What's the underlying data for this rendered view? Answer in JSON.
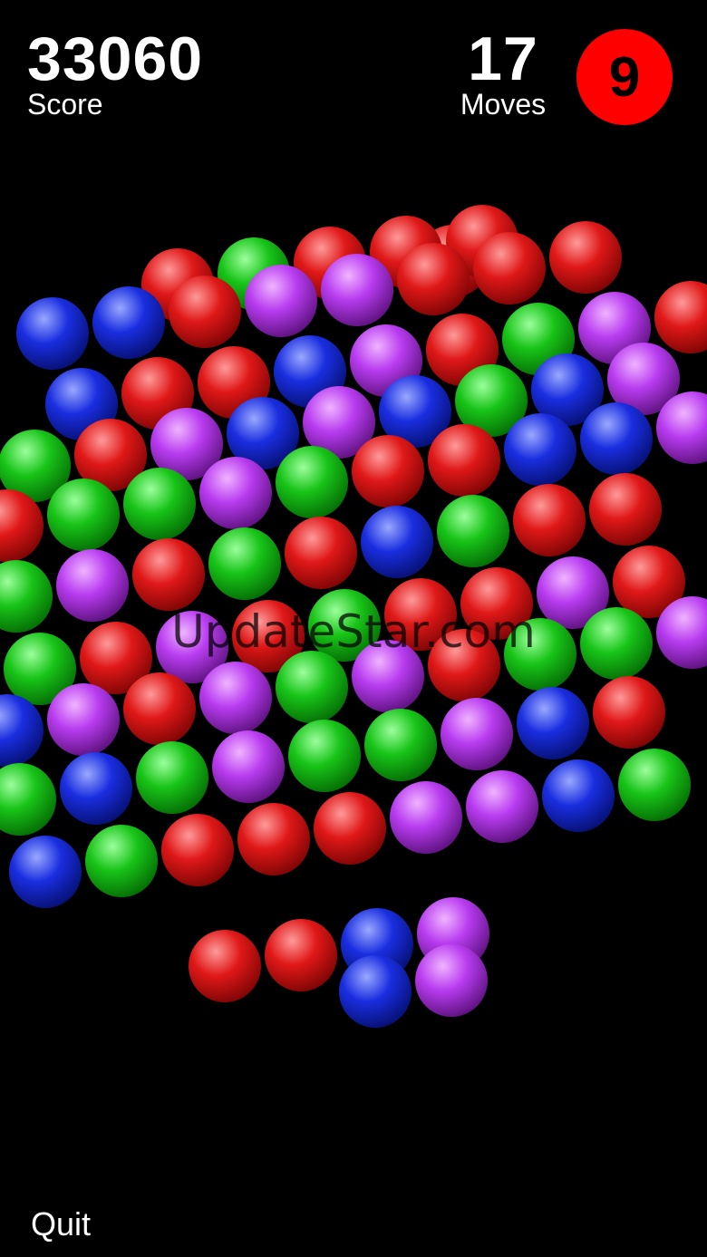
{
  "hud": {
    "score_value": "33060",
    "score_label": "Score",
    "moves_value": "17",
    "moves_label": "Moves",
    "level_value": "9"
  },
  "watermark": "UpdateStar.com",
  "quit_label": "Quit",
  "colors": {
    "red": "#e01818",
    "green": "#18c418",
    "blue": "#1a2ee0",
    "purple": "#b83cf0",
    "badge": "#ff0000"
  },
  "board": {
    "shape": "hexagonal cluster of balls",
    "rows": [
      [
        "red"
      ],
      [
        "red",
        "green",
        "red",
        "red",
        "red"
      ],
      [
        "blue",
        "blue",
        "red",
        "purple",
        "purple",
        "red",
        "red",
        "red"
      ],
      [
        "blue",
        "red",
        "red",
        "blue",
        "purple",
        "red",
        "green",
        "purple",
        "red"
      ],
      [
        "green",
        "red",
        "purple",
        "blue",
        "purple",
        "blue",
        "green",
        "blue",
        "purple"
      ],
      [
        "red",
        "green",
        "green",
        "purple",
        "green",
        "red",
        "red",
        "blue",
        "blue",
        "purple"
      ],
      [
        "green",
        "purple",
        "red",
        "green",
        "red",
        "blue",
        "green",
        "red",
        "red"
      ],
      [
        "green",
        "red",
        "purple",
        "red",
        "green",
        "red",
        "red",
        "purple",
        "red"
      ],
      [
        "blue",
        "purple",
        "red",
        "purple",
        "green",
        "purple",
        "red",
        "green",
        "green",
        "purple"
      ],
      [
        "green",
        "blue",
        "green",
        "purple",
        "green",
        "green",
        "purple",
        "blue",
        "red"
      ],
      [
        "blue",
        "green",
        "red",
        "red",
        "red",
        "purple",
        "purple",
        "blue",
        "green"
      ],
      [
        "red",
        "red",
        "blue",
        "purple"
      ],
      [
        "blue",
        "purple"
      ]
    ]
  }
}
